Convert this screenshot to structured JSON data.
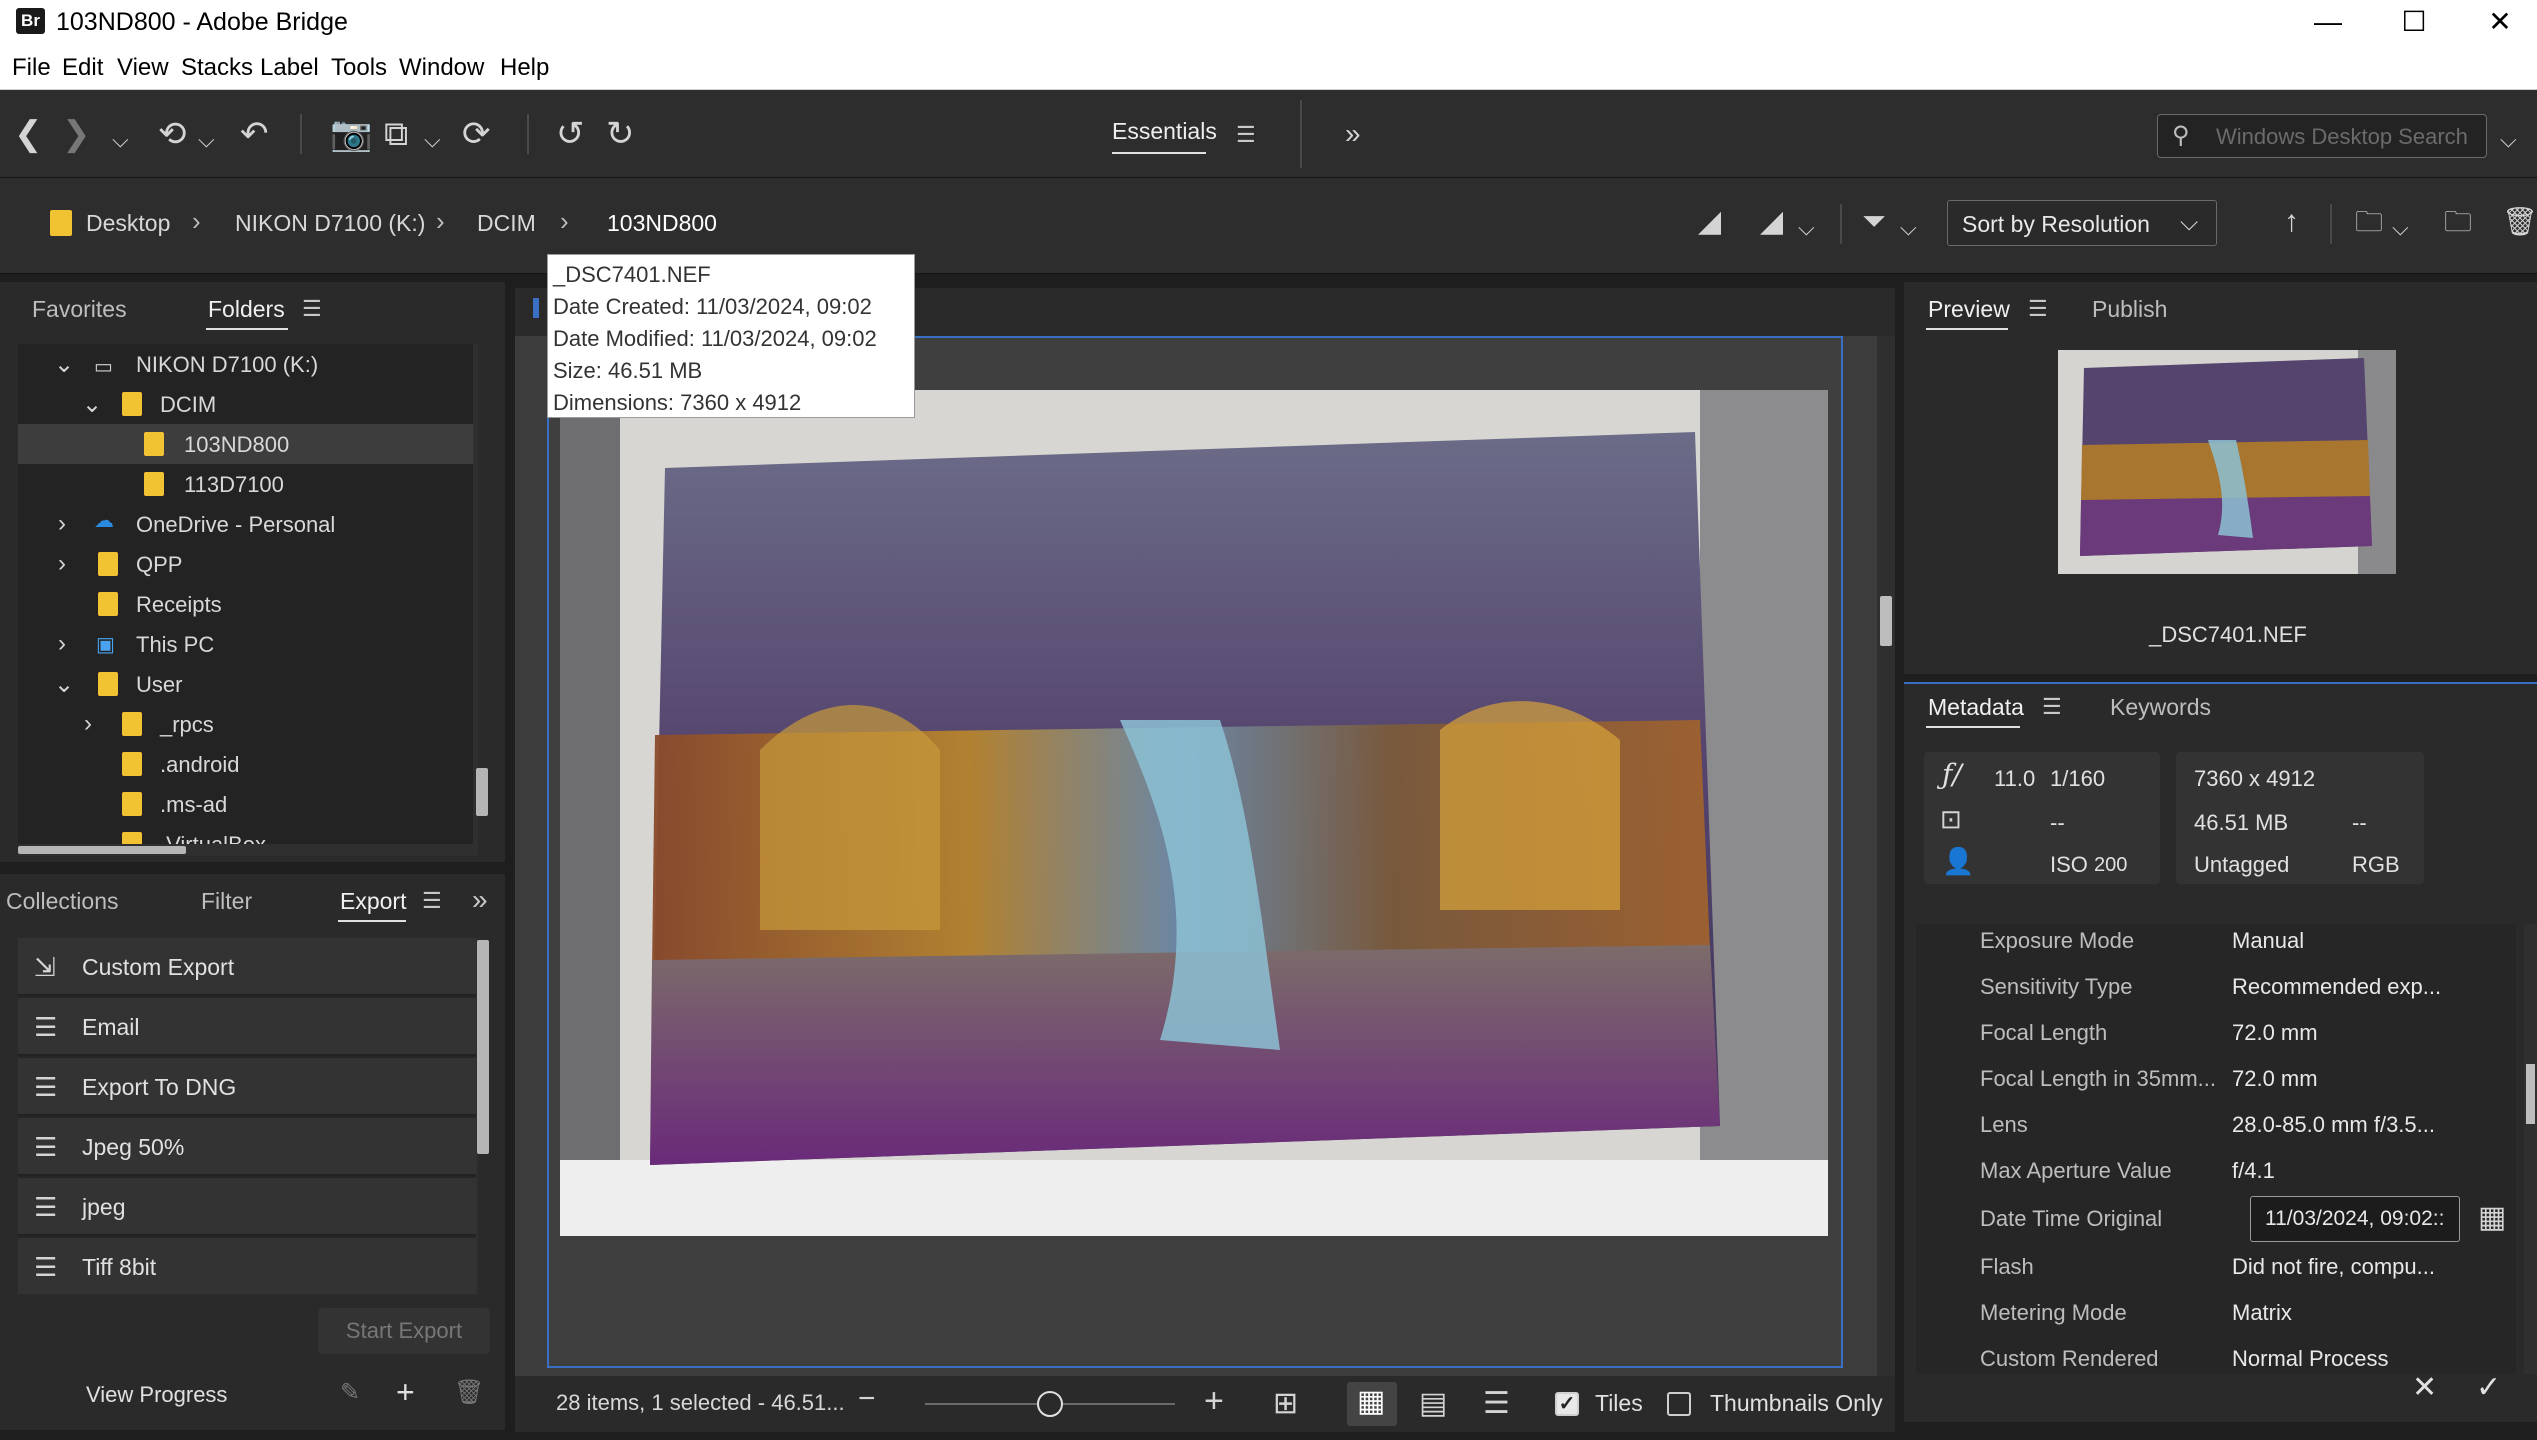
{
  "window": {
    "app_badge": "Br",
    "title": "103ND800 - Adobe Bridge",
    "minimize": "—",
    "maximize": "☐",
    "close": "✕"
  },
  "menu": [
    "File",
    "Edit",
    "View",
    "Stacks",
    "Label",
    "Tools",
    "Window",
    "Help"
  ],
  "toolbar": {
    "workspace": "Essentials",
    "search_placeholder": "Windows Desktop Search"
  },
  "path": {
    "crumbs": [
      "Desktop",
      "NIKON D7100 (K:)",
      "DCIM",
      "103ND800"
    ],
    "sort_label": "Sort by Resolution"
  },
  "left_top_panel": {
    "tabs": [
      "Favorites",
      "Folders"
    ],
    "active_tab": "Folders",
    "tree": [
      {
        "label": "NIKON D7100 (K:)",
        "expanded": true
      },
      {
        "label": "DCIM",
        "expanded": true
      },
      {
        "label": "103ND800",
        "selected": true
      },
      {
        "label": "113D7100"
      },
      {
        "label": "OneDrive - Personal",
        "expanded": false
      },
      {
        "label": "QPP",
        "expanded": false
      },
      {
        "label": "Receipts"
      },
      {
        "label": "This PC",
        "expanded": false
      },
      {
        "label": "User",
        "expanded": true
      },
      {
        "label": "_rpcs",
        "expanded": false
      },
      {
        "label": ".android"
      },
      {
        "label": ".ms-ad"
      },
      {
        "label": ".VirtualBox"
      }
    ]
  },
  "left_bottom_panel": {
    "tabs": [
      "Collections",
      "Filter",
      "Export"
    ],
    "active_tab": "Export",
    "presets": [
      "Custom Export",
      "Email",
      "Export To DNG",
      "Jpeg 50%",
      "jpeg",
      "Tiff 8bit"
    ],
    "start_export": "Start Export",
    "view_progress": "View Progress"
  },
  "tooltip": {
    "lines": [
      "_DSC7401.NEF",
      "Date Created: 11/03/2024, 09:02",
      "Date Modified: 11/03/2024, 09:02",
      "Size: 46.51 MB",
      "Dimensions: 7360 x 4912"
    ]
  },
  "status": {
    "text": "28 items, 1 selected - 46.51...",
    "zoom_fraction": 0.5,
    "tiles_label": "Tiles",
    "tiles_checked": true,
    "thumbs_only_label": "Thumbnails Only",
    "thumbs_only_checked": false
  },
  "preview": {
    "tabs": [
      "Preview",
      "Publish"
    ],
    "active_tab": "Preview",
    "filename": "_DSC7401.NEF"
  },
  "metadata": {
    "tabs": [
      "Metadata",
      "Keywords"
    ],
    "active_tab": "Metadata",
    "aperture_symbol": "ƒ/",
    "aperture": "11.0",
    "shutter": "1/160",
    "meter": "--",
    "iso_label": "ISO",
    "iso": "200",
    "dimensions": "7360 x 4912",
    "size": "46.51 MB",
    "dash": "--",
    "label": "Untagged",
    "color_mode": "RGB",
    "fields": [
      {
        "key": "Exposure Mode",
        "value": "Manual"
      },
      {
        "key": "Sensitivity Type",
        "value": "Recommended exp..."
      },
      {
        "key": "Focal Length",
        "value": "72.0 mm"
      },
      {
        "key": "Focal Length in 35mm...",
        "value": "72.0 mm"
      },
      {
        "key": "Lens",
        "value": "28.0-85.0 mm f/3.5..."
      },
      {
        "key": "Max Aperture Value",
        "value": "f/4.1"
      },
      {
        "key": "Date Time Original",
        "value": ""
      },
      {
        "key": "Flash",
        "value": "Did not fire, compu..."
      },
      {
        "key": "Metering Mode",
        "value": "Matrix"
      },
      {
        "key": "Custom Rendered",
        "value": "Normal Process"
      }
    ],
    "date_time_value": "11/03/2024, 09:02::"
  },
  "colors": {
    "accent_blue": "#3a6fc4",
    "folder_yellow": "#f1c232",
    "panel_bg": "#2a2a2a"
  }
}
